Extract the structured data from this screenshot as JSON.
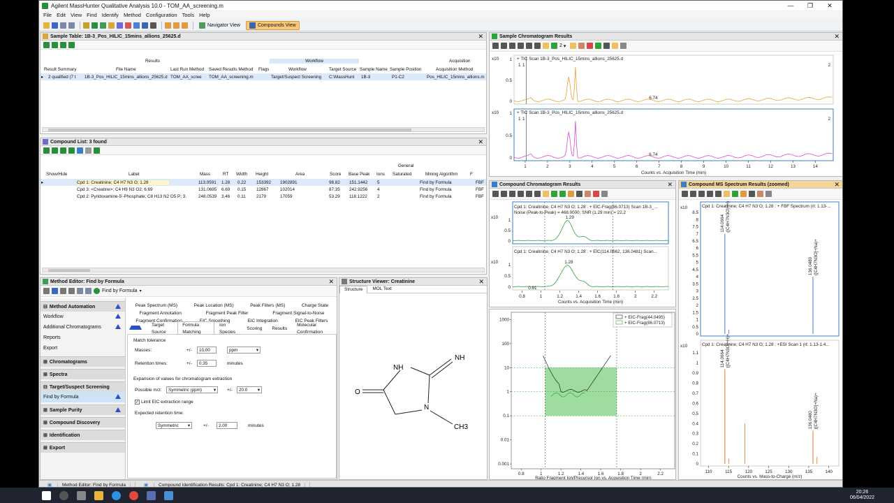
{
  "window": {
    "title": "Agilent MassHunter Qualitative Analysis 10.0 - TOM_AA_screening.m"
  },
  "menu": [
    "File",
    "Edit",
    "View",
    "Find",
    "Identify",
    "Method",
    "Configuration",
    "Tools",
    "Help"
  ],
  "toolbar": {
    "navigator_view": "Navigator View",
    "compounds_view": "Compounds View"
  },
  "sample_table": {
    "title": "Sample Table: 1B-3_Pos_HILIC_15mins_allions_25625.d",
    "groups": {
      "results": "Results",
      "workflow": "Workflow",
      "acquisition": "Acquisition"
    },
    "columns": [
      "Result Summary",
      "File Name",
      "Last Run Method",
      "Saved Results Method",
      "Flags",
      "Workflow",
      "Target Source",
      "Sample Name",
      "Sample Position",
      "Acquisition Method"
    ],
    "row": [
      "2 qualified (7 t",
      "1B-3_Pos_HILIC_15mins_allions_25625.d",
      "TOM_AA_scree",
      "TOM_AA_screening.m",
      "",
      "Target/Suspect Screening",
      "C:\\MassHunt",
      "1B-3",
      "P1-C2",
      "Pos_HILIC_15mins_allions.m"
    ]
  },
  "compound_list": {
    "title": "Compound List: 3 found",
    "group": "General",
    "columns": [
      "Show/Hide",
      "Label",
      "Mass",
      "RT",
      "Width",
      "Height",
      "Area",
      "Score",
      "Base Peak",
      "Ions",
      "Saturated",
      "Mining Algorithm",
      "F"
    ],
    "rows": [
      [
        "Cpd 1: Creatinine; C4 H7 N3 O; 1.28",
        "113.0591",
        "1.28",
        "0.22",
        "153392",
        "1902891",
        "98.82",
        "151.1442",
        "5",
        "",
        "Find by Formula",
        "FBF"
      ],
      [
        "Cpd 3: <Creatine>; C4 H9 N3 O2; 6.69",
        "131.0695",
        "6.69",
        "0.15",
        "12867",
        "102014",
        "87.35",
        "242.9256",
        "4",
        "",
        "Find by Formula",
        "FBF"
      ],
      [
        "Cpd 2: Pyridoxamine-5'-Phosphate; C8 H13 N2 O5 P; 3.",
        "248.0539",
        "3.46",
        "0.11",
        "2179",
        "17059",
        "53.29",
        "118.1222",
        "2",
        "",
        "Find by Formula",
        "FBF"
      ]
    ]
  },
  "method_editor": {
    "title": "Method Editor: Find by Formula",
    "toolbar_label": "Find by Formula",
    "nav": {
      "method_automation": "Method Automation",
      "items": [
        "Workflow",
        "Additional Chromatograms",
        "Reports",
        "Export"
      ],
      "groups": [
        "Chromatograms",
        "Spectra",
        "Target/Suspect Screening",
        "Sample Purity",
        "Compound Discovery",
        "Identification",
        "Export"
      ],
      "tss_item": "Find by Formula"
    },
    "tabs_row1": [
      "Peak Spectrum (MS)",
      "Peak Location (MS)",
      "Peak Filters (MS)",
      "Charge State"
    ],
    "tabs_row2": [
      "Fragment Annotation",
      "Fragment Peak Filter",
      "Fragment Signal-to-Noise"
    ],
    "tabs_row3": [
      "Fragment Confirmation",
      "EIC Smoothing",
      "EIC Integration",
      "EIC Peak Filters"
    ],
    "tabs_row4": [
      "Target Source",
      "Formula Matching",
      "Ion Species",
      "Scoring",
      "Results",
      "Molecular Confirmation"
    ],
    "match_tolerance": "Match tolerance",
    "masses_label": "Masses:",
    "masses_pm": "+/-",
    "masses_value": "10.00",
    "masses_unit": "ppm",
    "rt_label": "Retention times:",
    "rt_pm": "+/-",
    "rt_value": "0.35",
    "rt_unit": "minutes",
    "expansion_label": "Expansion of values for chromatogram extraction",
    "possible_mz_label": "Possible m/z:",
    "possible_mz_mode": "Symmetric (ppm)",
    "possible_mz_pm": "+/-",
    "possible_mz_value": "20.0",
    "limit_eic": "Limit EIC extraction range",
    "expected_rt_label": "Expected retention time:",
    "expected_rt_mode": "Symmetric",
    "expected_rt_pm": "+/-",
    "expected_rt_value": "2.00",
    "expected_rt_unit": "minutes"
  },
  "structure_viewer": {
    "title": "Structure Viewer: Creatinine",
    "tabs": [
      "Structure",
      "MOL Text"
    ],
    "atoms": {
      "nh": "NH",
      "nh_imine": "NH",
      "o": "O",
      "n": "N",
      "ch3": "CH3"
    }
  },
  "sample_chromatogram": {
    "title": "Sample Chromatogram Results",
    "plot1_label": "+ TIC Scan 1B-3_Pos_HILIC_15mins_allions_25625.d",
    "plot2_label": "+ TIC Scan 1B-3_Pos_HILIC_15mins_allions_25625.d",
    "y_exp": "x10",
    "marks": [
      "1",
      "2"
    ],
    "ann1": "6.74",
    "ann2": "6.74",
    "xticks": [
      "1",
      "2",
      "3",
      "4",
      "5",
      "6",
      "7",
      "8",
      "9",
      "10",
      "11",
      "12",
      "13",
      "14"
    ],
    "yticks": [
      "1",
      "0.5",
      "0"
    ],
    "xlabel": "Counts vs. Acquisition Time (min)",
    "zoom": "2"
  },
  "compound_chromatogram": {
    "title": "Compound Chromatogram Results",
    "plot1_label": "Cpd 1: Creatinine; C4 H7 N3 O; 1.28 : + EIC-Frag(86.0713) Scan 1B-3_...",
    "plot1_noise": "Noise (Peak-to-Peak) = 468.0000; SNR (1.29 min) = 22.2",
    "plot1_peak": "1.29",
    "plot2_label": "Cpd 1: Creatinine; C4 H7 N3 O; 1.28 : + EIC(114.0662, 136.0481) Scan...",
    "plot2_peak": "1.28",
    "plot2_ann": "0.91",
    "y_exp": "x10",
    "yticks1": [
      "1",
      "0.5",
      "0"
    ],
    "yticks2": [
      "1",
      "0.5",
      "0"
    ],
    "xticks": [
      "0.8",
      "1",
      "1.2",
      "1.4",
      "1.6",
      "1.8",
      "2",
      "2.2"
    ],
    "xlabel": "Counts vs. Acquisition Time (min)"
  },
  "ratio_plot": {
    "legend": [
      "+ EIC-Frag(44.0495)",
      "+ EIC-Frag(86.0713)"
    ],
    "yticks": [
      "1000",
      "100",
      "10",
      "1",
      "0.1",
      "0.01",
      "0.001"
    ],
    "xticks": [
      "0.8",
      "1",
      "1.2",
      "1.4",
      "1.6",
      "1.8",
      "2",
      "2.2"
    ],
    "xlabel": "Ratio Fragment Ion/Precursor Ion vs. Acquisition Time (min)"
  },
  "ms_spectrum": {
    "title": "Compound MS Spectrum Results (zoomed)",
    "plot1_label": "Cpd 1: Creatinine; C4 H7 N3 O; 1.28 : + FBF Spectrum (rt: 1.13-...",
    "plot1_peak1": "114.0664",
    "plot1_peak1_ion": "([C4H7N3O]+H)+",
    "plot1_peak2": "136.0480",
    "plot1_peak2_ion": "([C4H7N3O]+Na)+",
    "plot2_label": "Cpd 1: Creatinine; C4 H7 N3 O; 1.28 : +ESI Scan 1 (rt: 1.13-1.4...",
    "plot2_peak1": "114.0664",
    "plot2_peak1_ion": "([C4H7N3O]+H)+",
    "plot2_peak2": "136.0480",
    "plot2_peak2_ion": "([C4H7N3O]+Na)+",
    "y_exp": "x10",
    "yticks1": [
      "8.5",
      "8",
      "7.5",
      "7",
      "6.5",
      "6",
      "5.5",
      "5",
      "4.5",
      "4",
      "3.5",
      "3",
      "2.5",
      "2",
      "1.5",
      "1",
      "0.5",
      "0"
    ],
    "yticks2": [
      "1.1",
      "1",
      "0.9",
      "0.8",
      "0.7",
      "0.6",
      "0.5",
      "0.4",
      "0.3",
      "0.2",
      "0.1",
      "0"
    ],
    "xticks": [
      "110",
      "115",
      "120",
      "125",
      "130",
      "135",
      "140"
    ],
    "xlabel": "Counts vs. Mass-to-Charge (m/z)"
  },
  "statusbar": {
    "item1": "Method Editor: Find by Formula",
    "item2": "Compound Identification Results: Cpd 1: Creatinine; C4 H7 N3 O; 1.28"
  },
  "taskbar": {
    "time": "20:26",
    "date": "06/04/2022"
  },
  "colors": {
    "accent_orange": "#f6d59a",
    "green_trace": "#2fa33a",
    "orange_trace": "#e8a23c",
    "magenta_trace": "#d64fcf",
    "blue_peak": "#3d78d8",
    "orange_peak": "#e0782e"
  }
}
